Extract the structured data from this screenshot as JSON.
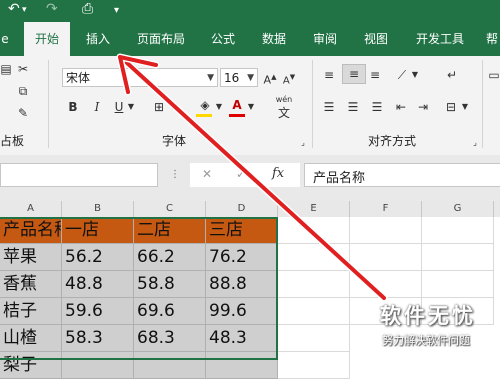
{
  "quick_access": {
    "undo_icon": "↶",
    "redo_icon": "↷",
    "preview_icon": "⎙",
    "more_icon": "▾"
  },
  "tabs": {
    "file_partial": "e",
    "home": "开始",
    "insert": "插入",
    "page_layout": "页面布局",
    "formulas": "公式",
    "data": "数据",
    "review": "审阅",
    "view": "视图",
    "developer": "开发工具",
    "help_partial": "帮"
  },
  "ribbon": {
    "font_name": "宋体",
    "font_size": "16",
    "bold": "B",
    "italic": "I",
    "underline": "U",
    "font_color_letter": "A",
    "wen_label": "wén",
    "wen_char": "文",
    "clipboard_label": "占板",
    "font_group_label": "字体",
    "align_group_label": "对齐方式"
  },
  "formula": {
    "cancel_icon": "✕",
    "enter_icon": "✓",
    "fx_label": "fx",
    "content": "产品名称"
  },
  "columns": [
    "A",
    "B",
    "C",
    "D",
    "E",
    "F",
    "G"
  ],
  "table": {
    "header": [
      "产品名称",
      "一店",
      "二店",
      "三店"
    ],
    "rows": [
      [
        "苹果",
        "56.2",
        "66.2",
        "76.2"
      ],
      [
        "香蕉",
        "48.8",
        "58.8",
        "88.8"
      ],
      [
        "桔子",
        "59.6",
        "69.6",
        "99.6"
      ],
      [
        "山楂",
        "58.3",
        "68.3",
        "48.3"
      ],
      [
        "梨子",
        "",
        "",
        ""
      ]
    ]
  },
  "watermark": {
    "title": "软件无忧",
    "subtitle": "努力解决软件问题"
  },
  "colors": {
    "excel_green": "#217346",
    "header_fill": "#c65911",
    "data_fill": "#cfcfcf",
    "arrow_red": "#e02020"
  }
}
